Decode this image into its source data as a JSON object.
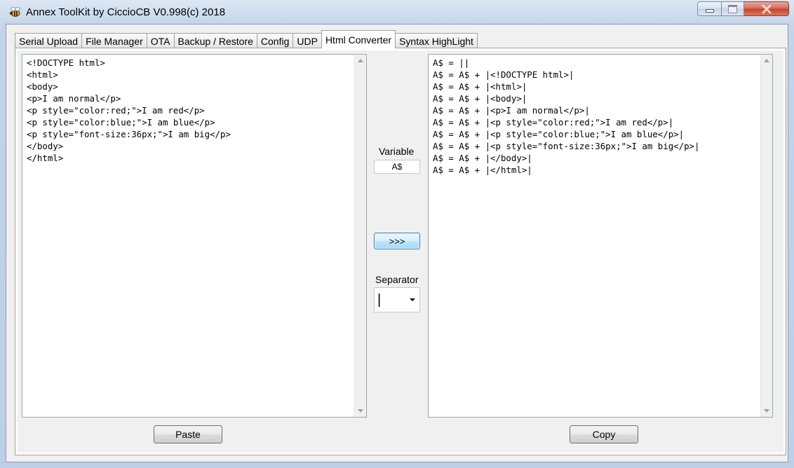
{
  "window": {
    "title": "Annex ToolKit by CiccioCB V0.998(c) 2018"
  },
  "tabs": [
    {
      "label": "Serial Upload",
      "active": false
    },
    {
      "label": "File Manager",
      "active": false
    },
    {
      "label": "OTA",
      "active": false
    },
    {
      "label": "Backup / Restore",
      "active": false
    },
    {
      "label": "Config",
      "active": false
    },
    {
      "label": "UDP",
      "active": false
    },
    {
      "label": "Html Converter",
      "active": true
    },
    {
      "label": "Syntax HighLight",
      "active": false
    }
  ],
  "converter": {
    "input_text": "<!DOCTYPE html>\n<html>\n<body>\n<p>I am normal</p>\n<p style=\"color:red;\">I am red</p>\n<p style=\"color:blue;\">I am blue</p>\n<p style=\"font-size:36px;\">I am big</p>\n</body>\n</html>",
    "output_text": "A$ = ||\nA$ = A$ + |<!DOCTYPE html>|\nA$ = A$ + |<html>|\nA$ = A$ + |<body>|\nA$ = A$ + |<p>I am normal</p>|\nA$ = A$ + |<p style=\"color:red;\">I am red</p>|\nA$ = A$ + |<p style=\"color:blue;\">I am blue</p>|\nA$ = A$ + |<p style=\"font-size:36px;\">I am big</p>|\nA$ = A$ + |</body>|\nA$ = A$ + |</html>|",
    "variable_label": "Variable",
    "variable_value": "A$",
    "convert_label": ">>>",
    "separator_label": "Separator",
    "separator_value": "|",
    "paste_label": "Paste",
    "copy_label": "Copy"
  },
  "colors": {
    "window_frame": "#c2d4ea",
    "close_button": "#c7432a",
    "convert_button": "#bee6fd"
  }
}
